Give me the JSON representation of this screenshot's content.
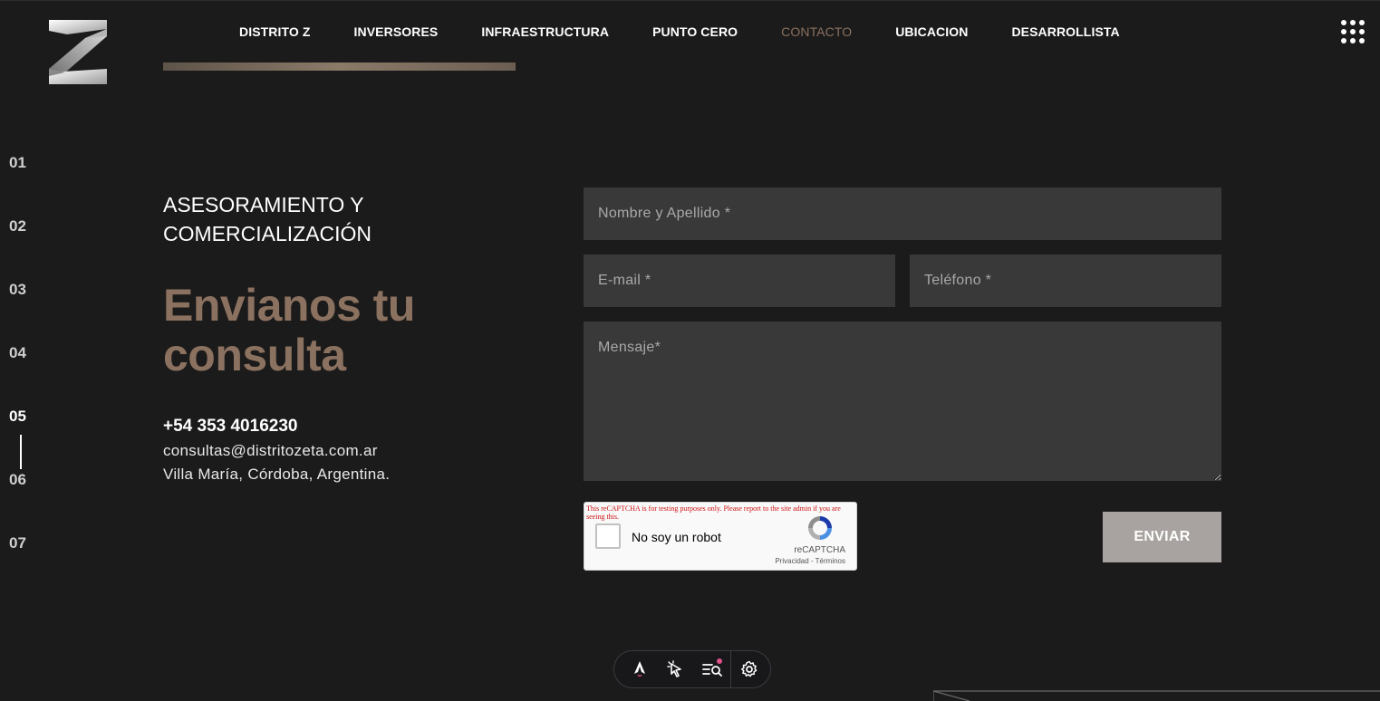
{
  "nav": {
    "items": [
      "DISTRITO Z",
      "INVERSORES",
      "INFRAESTRUCTURA",
      "PUNTO CERO",
      "CONTACTO",
      "UBICACION",
      "DESARROLLISTA"
    ],
    "active": "CONTACTO",
    "menu_icon": "grid-dots-icon"
  },
  "sections": [
    "01",
    "02",
    "03",
    "04",
    "05",
    "06",
    "07"
  ],
  "active_section": "05",
  "contact": {
    "subtitle": "ASESORAMIENTO Y COMERCIALIZACIÓN",
    "headline": "Envianos tu consulta",
    "phone": "+54 353 4016230",
    "email": "consultas@distritozeta.com.ar",
    "address": "Villa María, Córdoba, Argentina."
  },
  "form": {
    "name_placeholder": "Nombre y Apellido *",
    "email_placeholder": "E-mail *",
    "phone_placeholder": "Teléfono *",
    "message_placeholder": "Mensaje*",
    "submit_label": "ENVIAR"
  },
  "recaptcha": {
    "warning": "This reCAPTCHA is for testing purposes only. Please report to the site admin if you are seeing this.",
    "label": "No soy un robot",
    "brand": "reCAPTCHA",
    "links": "Privacidad - Términos"
  },
  "devtoolbar": {
    "icons": [
      "astro-icon",
      "cursor-inspect-icon",
      "audit-search-icon",
      "settings-gear-icon"
    ]
  },
  "colors": {
    "background": "#1c1b1b",
    "accent": "#8b715f",
    "field": "#3a3939",
    "button": "#a8a3a0"
  }
}
